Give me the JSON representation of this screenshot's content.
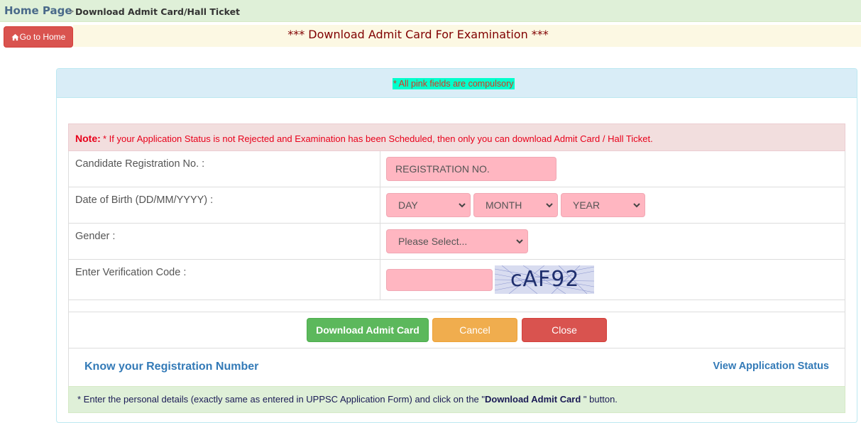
{
  "breadcrumb": {
    "home": "Home Page",
    "separator": ">",
    "current": "Download Admit Card/Hall Ticket"
  },
  "header": {
    "home_button": "Go to Home",
    "home_icon": "home-icon",
    "title": "*** Download Admit Card For Examination ***"
  },
  "panel": {
    "compulsory_note": "* All pink fields are compulsory"
  },
  "note": {
    "label": "Note:",
    "text": "* If your Application Status is not Rejected and Examination has been Scheduled, then only you can download Admit Card / Hall Ticket."
  },
  "form": {
    "registration": {
      "label": "Candidate Registration No. :",
      "placeholder": "REGISTRATION NO.",
      "value": ""
    },
    "dob": {
      "label": "Date of Birth (DD/MM/YYYY) :",
      "day": "DAY",
      "month": "MONTH",
      "year": "YEAR"
    },
    "gender": {
      "label": "Gender :",
      "selected": "Please Select..."
    },
    "verification": {
      "label": "Enter Verification Code :",
      "value": "",
      "captcha_text": "cAF92"
    }
  },
  "buttons": {
    "download": "Download Admit Card",
    "cancel": "Cancel",
    "close": "Close"
  },
  "links": {
    "know_registration": "Know your Registration Number",
    "view_status": "View Application Status"
  },
  "footer": {
    "prefix": "* Enter the personal details (exactly same as entered in UPPSC Application Form) and click on the \"",
    "bold": "Download Admit Card",
    "suffix": " \" button."
  },
  "colors": {
    "pink_field": "#ffb6c1",
    "title": "#800000",
    "note": "#e8001a",
    "link": "#337ab7",
    "success": "#5cb85c",
    "warning": "#f0ad4e",
    "danger": "#d9534f"
  }
}
